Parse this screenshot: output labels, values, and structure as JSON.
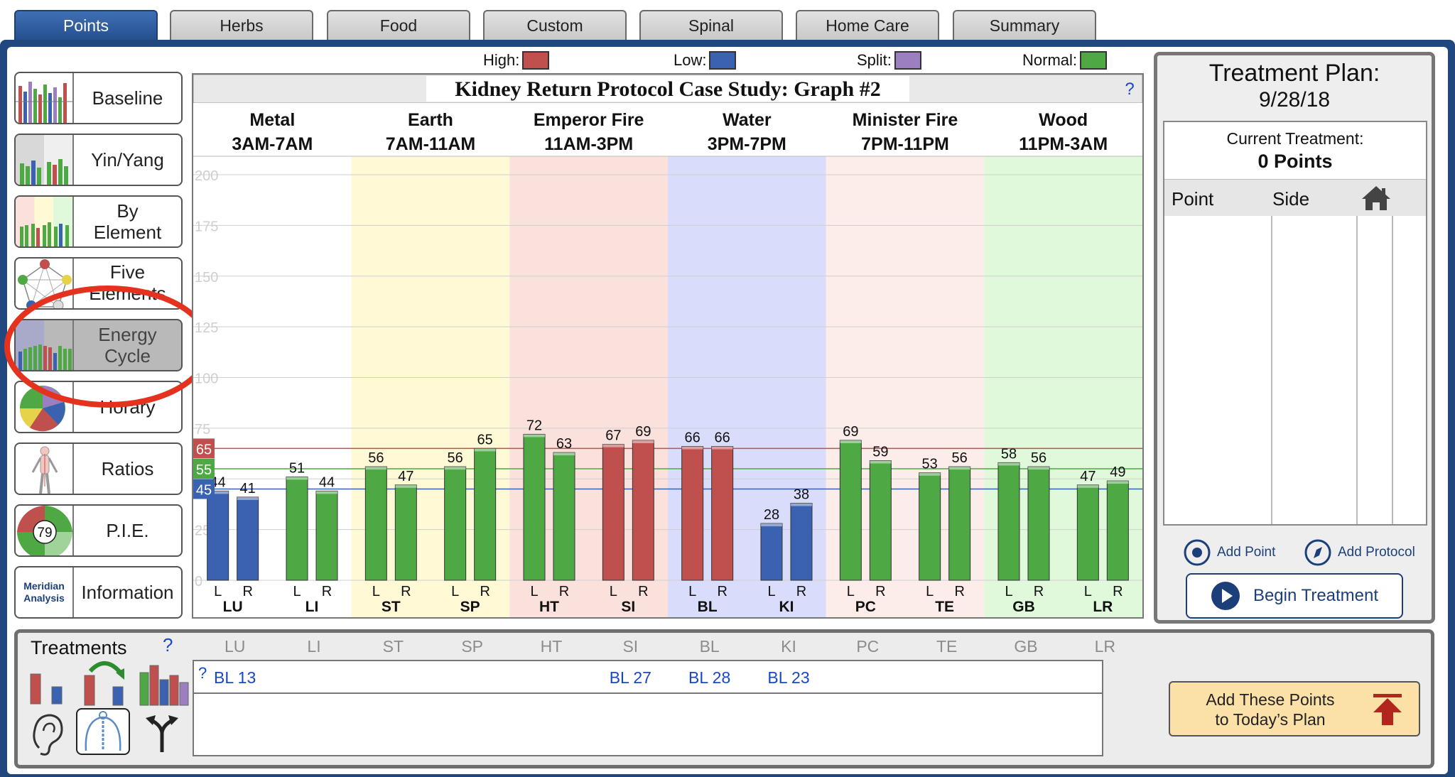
{
  "tabs": [
    "Points",
    "Herbs",
    "Food",
    "Custom",
    "Spinal",
    "Home Care",
    "Summary"
  ],
  "active_tab": "Points",
  "nav": [
    {
      "id": "baseline",
      "label": "Baseline"
    },
    {
      "id": "yinyang",
      "label": "Yin/Yang"
    },
    {
      "id": "byelement",
      "label": "By\nElement"
    },
    {
      "id": "fiveelements",
      "label": "Five\nElements"
    },
    {
      "id": "energycycle",
      "label": "Energy\nCycle"
    },
    {
      "id": "horary",
      "label": "Horary"
    },
    {
      "id": "ratios",
      "label": "Ratios"
    },
    {
      "id": "pie",
      "label": "P.I.E."
    },
    {
      "id": "information",
      "label": "Information"
    }
  ],
  "pie_badge": "79",
  "meridian_thumb": "Meridian\nAnalysis",
  "legend": {
    "high": {
      "label": "High:",
      "color": "#c0504d"
    },
    "low": {
      "label": "Low:",
      "color": "#3b62b0"
    },
    "split": {
      "label": "Split:",
      "color": "#9b7fc0"
    },
    "normal": {
      "label": "Normal:",
      "color": "#4ea944"
    }
  },
  "help_mark": "?",
  "chart_data": {
    "type": "bar",
    "title": "Kidney Return Protocol Case Study: Graph #2",
    "ylim": [
      0,
      200
    ],
    "yticks": [
      0,
      25,
      50,
      75,
      100,
      125,
      150,
      175,
      200
    ],
    "reference_lines": [
      {
        "label": "65",
        "value": 65,
        "color": "#c0504d"
      },
      {
        "label": "55",
        "value": 55,
        "color": "#4ea944"
      },
      {
        "label": "45",
        "value": 45,
        "color": "#3b62b0"
      }
    ],
    "elements": [
      {
        "name": "Metal",
        "time": "3AM-7AM",
        "bg": "#ffffff"
      },
      {
        "name": "Earth",
        "time": "7AM-11AM",
        "bg": "#fff9d6"
      },
      {
        "name": "Emperor Fire",
        "time": "11AM-3PM",
        "bg": "#fbe1dc"
      },
      {
        "name": "Water",
        "time": "3PM-7PM",
        "bg": "#d9dcfb"
      },
      {
        "name": "Minister Fire",
        "time": "7PM-11PM",
        "bg": "#fcecea"
      },
      {
        "name": "Wood",
        "time": "11PM-3AM",
        "bg": "#e0f9db"
      }
    ],
    "categories": [
      "LU",
      "LI",
      "ST",
      "SP",
      "HT",
      "SI",
      "BL",
      "KI",
      "PC",
      "TE",
      "GB",
      "LR"
    ],
    "side_labels": [
      "L",
      "R"
    ],
    "series": [
      {
        "name": "L",
        "values": [
          44,
          51,
          56,
          56,
          72,
          67,
          66,
          28,
          69,
          53,
          58,
          47
        ]
      },
      {
        "name": "R",
        "values": [
          41,
          44,
          47,
          65,
          63,
          69,
          66,
          38,
          59,
          56,
          56,
          49
        ]
      }
    ],
    "colors": [
      [
        "low",
        "low"
      ],
      [
        "normal",
        "normal"
      ],
      [
        "normal",
        "normal"
      ],
      [
        "normal",
        "normal"
      ],
      [
        "normal",
        "normal"
      ],
      [
        "high",
        "high"
      ],
      [
        "high",
        "high"
      ],
      [
        "low",
        "low"
      ],
      [
        "normal",
        "normal"
      ],
      [
        "normal",
        "normal"
      ],
      [
        "normal",
        "normal"
      ],
      [
        "normal",
        "normal"
      ]
    ]
  },
  "plan": {
    "title": "Treatment Plan:",
    "date": "9/28/18",
    "current_label": "Current Treatment:",
    "current_count": "0 Points",
    "col_point": "Point",
    "col_side": "Side",
    "add_point": "Add Point",
    "add_protocol": "Add Protocol",
    "begin": "Begin Treatment"
  },
  "treatments": {
    "title": "Treatments",
    "help": "?",
    "row_help": "?",
    "points": [
      {
        "meridian": "LU",
        "label": "BL 13"
      },
      {
        "meridian": "SI",
        "label": "BL 27"
      },
      {
        "meridian": "BL",
        "label": "BL 28"
      },
      {
        "meridian": "KI",
        "label": "BL 23"
      }
    ],
    "add_button": "Add These Points\nto Today’s Plan"
  }
}
